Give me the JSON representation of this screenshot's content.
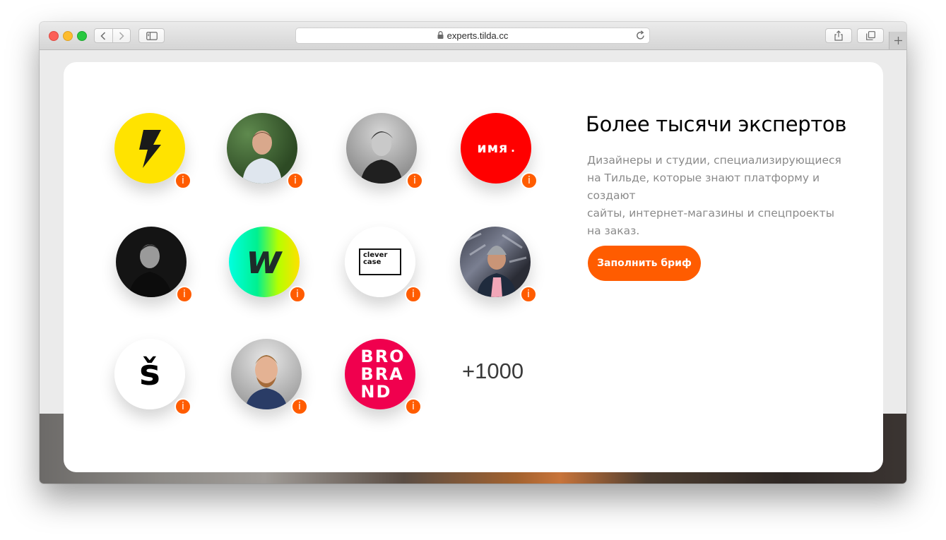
{
  "browser": {
    "url": "experts.tilda.cc"
  },
  "hero": {
    "title": "Более тысячи экспертов",
    "description_lines": [
      "Дизайнеры и студии, специализирующиеся",
      "на Тильде, которые знают платформу и создают",
      "сайты, интернет-магазины и спецпроекты",
      "на заказ."
    ],
    "cta_label": "Заполнить бриф"
  },
  "experts": {
    "logo_texts": {
      "imya": "имя",
      "clever_line1": "clever",
      "clever_line2": "case",
      "w_letter": "w",
      "s_letter": "š",
      "bro_line1": "BRO",
      "bro_line2": "BRA",
      "bro_line3": "ND"
    },
    "info_glyph": "i",
    "more_count": "+1000"
  },
  "colors": {
    "accent": "#ff5c00",
    "lightning_bg": "#ffe300",
    "imya_bg": "#ff0000",
    "brobrand_bg": "#f0004e"
  },
  "icons": {
    "lock": "lock-icon",
    "reload": "reload-icon",
    "share": "share-icon",
    "tabs": "tabs-icon",
    "sidebar": "sidebar-icon"
  }
}
